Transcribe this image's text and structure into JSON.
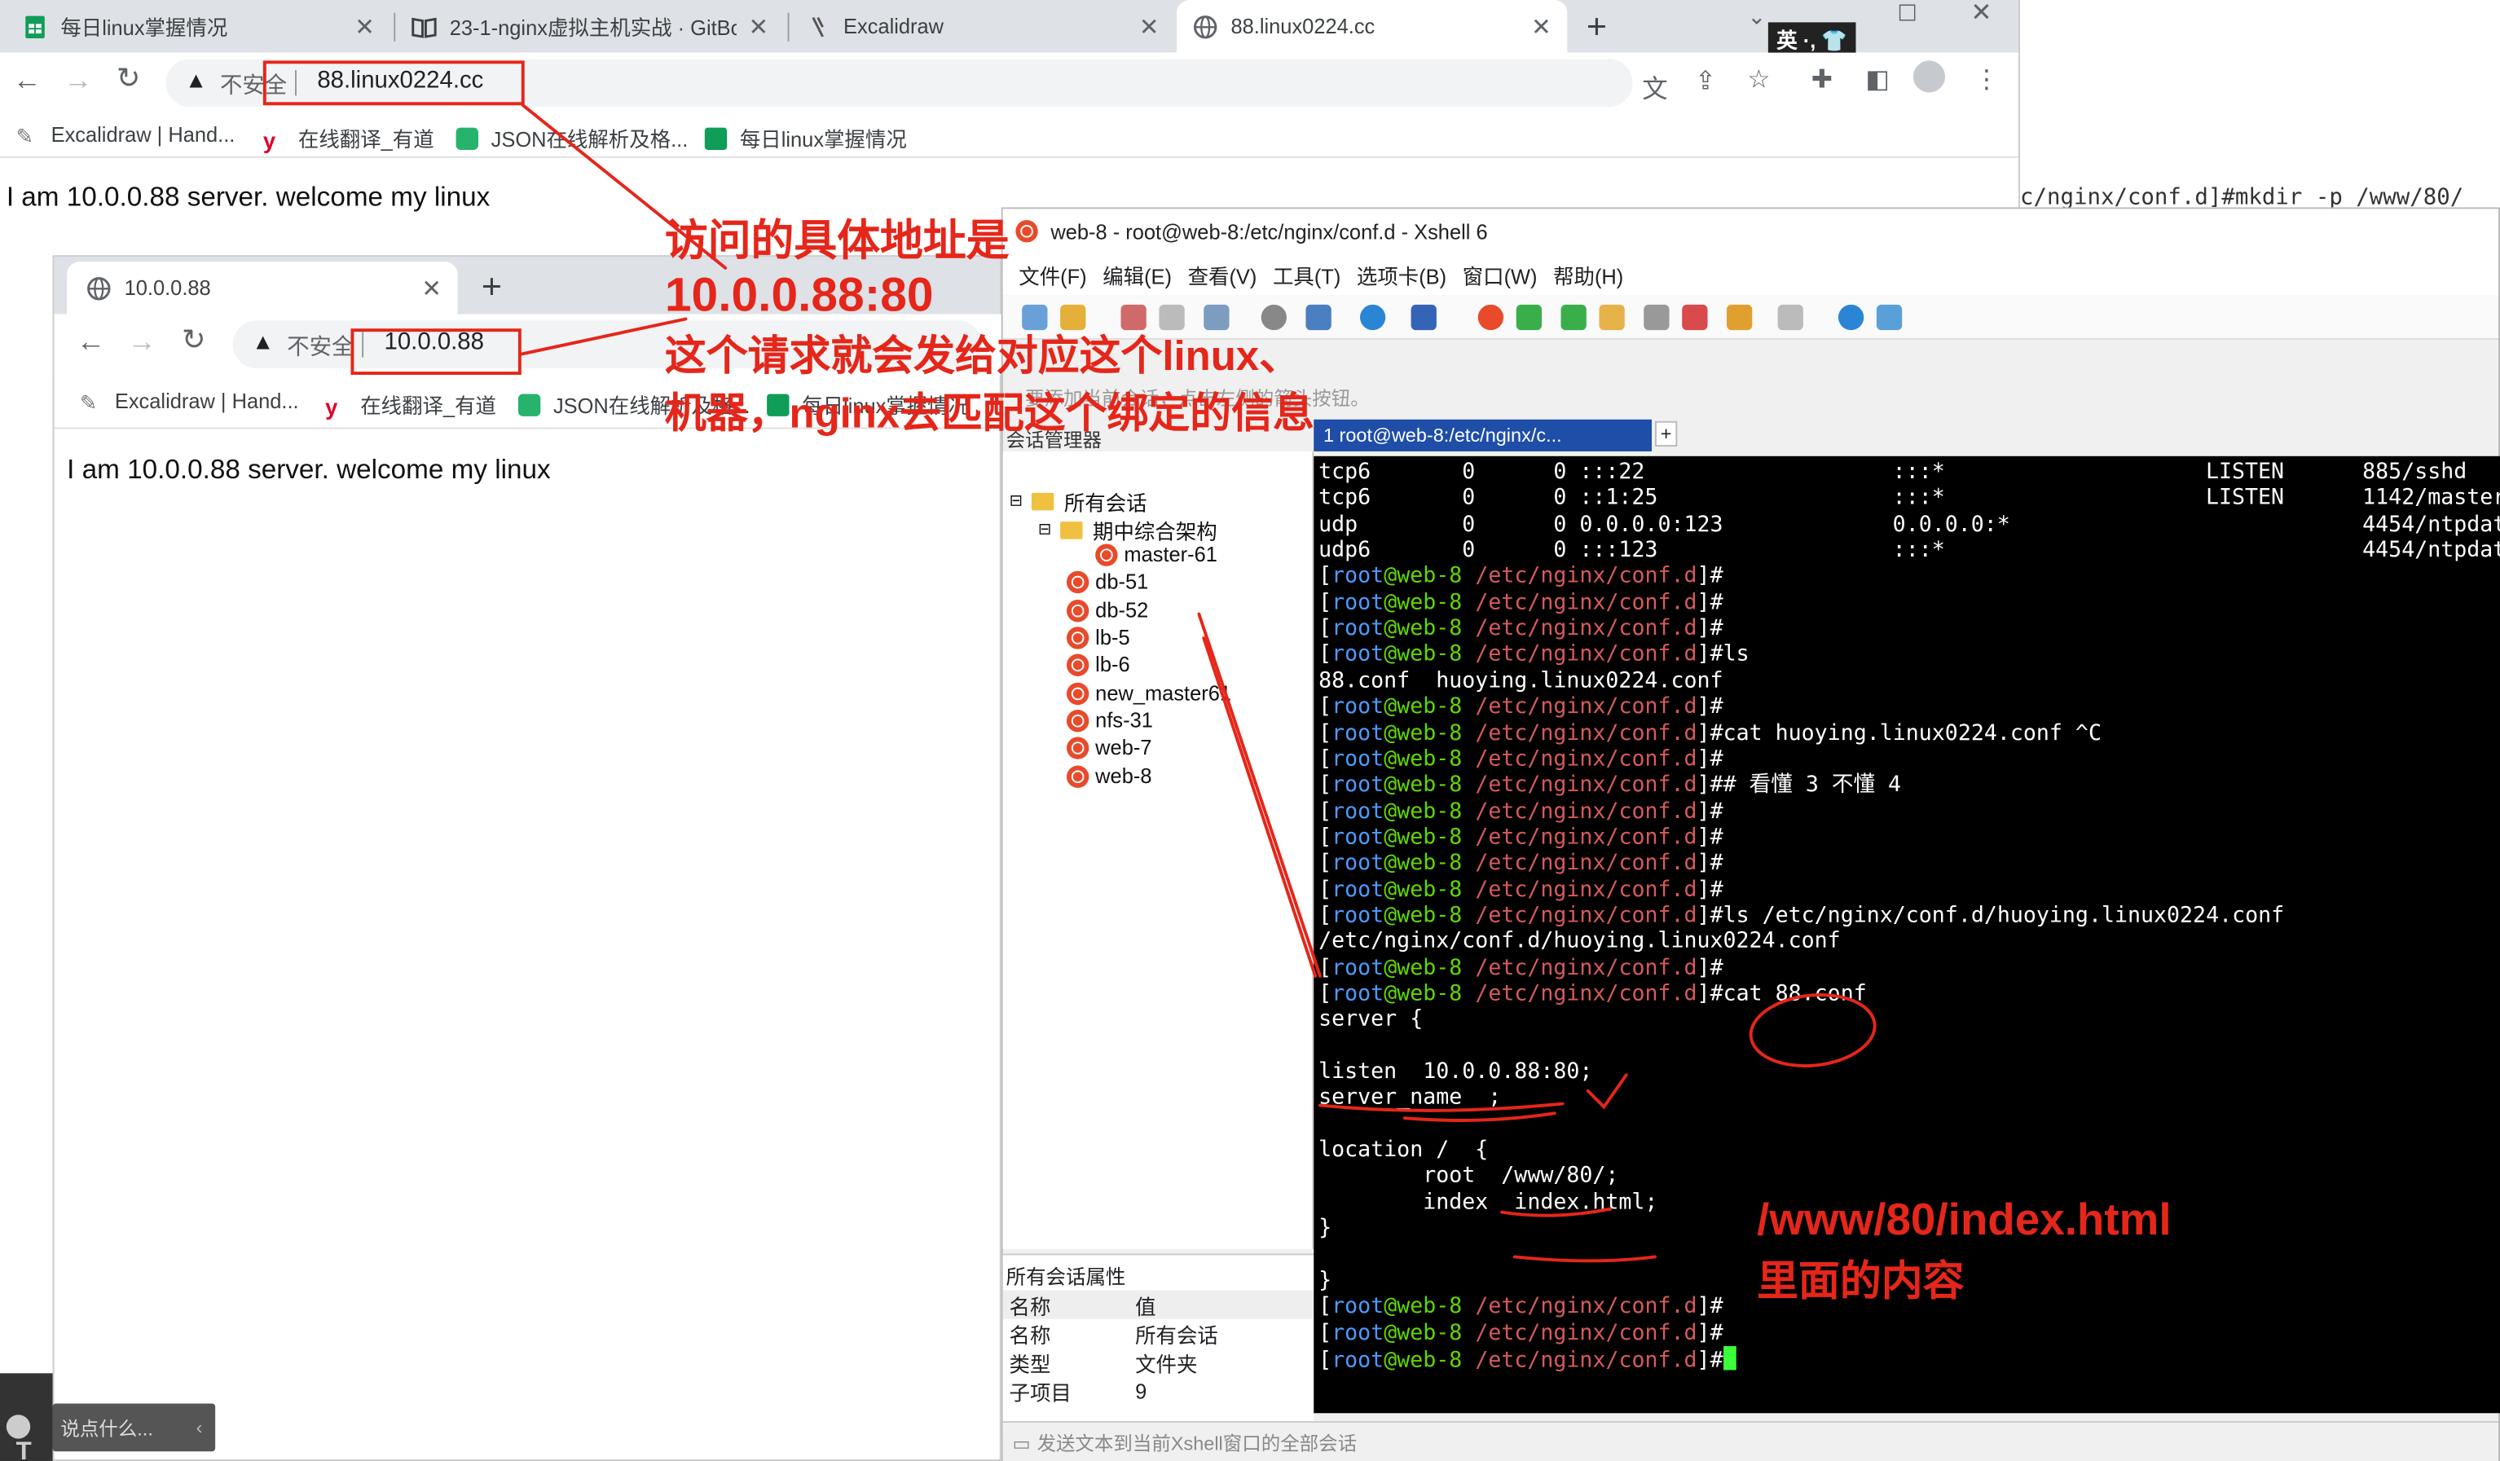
{
  "browser1": {
    "tabs": [
      {
        "label": "每日linux掌握情况"
      },
      {
        "label": "23-1-nginx虚拟主机实战 · GitBo"
      },
      {
        "label": "Excalidraw"
      },
      {
        "label": "88.linux0224.cc"
      }
    ],
    "address": {
      "security": "不安全",
      "url": "88.linux0224.cc"
    },
    "ime_badge": "英 ·, 👕",
    "bookmarks": [
      "Excalidraw | Hand...",
      "在线翻译_有道",
      "JSON在线解析及格...",
      "每日linux掌握情况"
    ],
    "page_text": "I am 10.0.0.88 server. welcome my linux",
    "behind_text": "c/nginx/conf.d]#mkdir -p /www/80/"
  },
  "browser2": {
    "tab": "10.0.0.88",
    "address": {
      "security": "不安全",
      "url": "10.0.0.88"
    },
    "bookmarks": [
      "Excalidraw | Hand...",
      "在线翻译_有道",
      "JSON在线解析及格...",
      "每日linux掌握情况"
    ],
    "page_text": "I am 10.0.0.88 server. welcome my linux"
  },
  "xshell": {
    "title": "web-8 - root@web-8:/etc/nginx/conf.d - Xshell 6",
    "menu": [
      "文件(F)",
      "编辑(E)",
      "查看(V)",
      "工具(T)",
      "选项卡(B)",
      "窗口(W)",
      "帮助(H)"
    ],
    "hint": "要添加当前会话，点击左侧的箭头按钮。",
    "session_manager_title": "会话管理器",
    "session_tab": "1 root@web-8:/etc/nginx/c...",
    "tree": [
      {
        "label": "所有会话",
        "kind": "folder",
        "level": 0
      },
      {
        "label": "期中综合架构",
        "kind": "folder",
        "level": 1
      },
      {
        "label": "master-61",
        "kind": "session",
        "level": 2
      },
      {
        "label": "db-51",
        "kind": "session",
        "level": 1
      },
      {
        "label": "db-52",
        "kind": "session",
        "level": 1
      },
      {
        "label": "lb-5",
        "kind": "session",
        "level": 1
      },
      {
        "label": "lb-6",
        "kind": "session",
        "level": 1
      },
      {
        "label": "new_master61",
        "kind": "session",
        "level": 1
      },
      {
        "label": "nfs-31",
        "kind": "session",
        "level": 1
      },
      {
        "label": "web-7",
        "kind": "session",
        "level": 1
      },
      {
        "label": "web-8",
        "kind": "session",
        "level": 1
      }
    ],
    "props": {
      "title": "所有会话属性",
      "headers": [
        "名称",
        "值"
      ],
      "rows": [
        [
          "名称",
          "所有会话"
        ],
        [
          "类型",
          "文件夹"
        ],
        [
          "子项目",
          "9"
        ]
      ]
    },
    "status_bar": "发送文本到当前Xshell窗口的全部会话",
    "prompt": {
      "user": "root",
      "host": "web-8",
      "path": "/etc/nginx/conf.d"
    },
    "terminal_lines": [
      {
        "type": "text",
        "text": "tcp6       0      0 :::22                   :::*                    LISTEN      885/sshd"
      },
      {
        "type": "text",
        "text": "tcp6       0      0 ::1:25                  :::*                    LISTEN      1142/master"
      },
      {
        "type": "text",
        "text": "udp        0      0 0.0.0.0:123             0.0.0.0:*                           4454/ntpdat"
      },
      {
        "type": "text",
        "text": "udp6       0      0 :::123                  :::*                                4454/ntpdat"
      },
      {
        "type": "prompt",
        "cmd": ""
      },
      {
        "type": "prompt",
        "cmd": ""
      },
      {
        "type": "prompt",
        "cmd": ""
      },
      {
        "type": "prompt",
        "cmd": "ls"
      },
      {
        "type": "text",
        "text": "88.conf  huoying.linux0224.conf"
      },
      {
        "type": "prompt",
        "cmd": ""
      },
      {
        "type": "prompt",
        "cmd": "cat huoying.linux0224.conf ^C"
      },
      {
        "type": "prompt",
        "cmd": ""
      },
      {
        "type": "prompt",
        "cmd": "# 看懂 3 不懂 4"
      },
      {
        "type": "prompt",
        "cmd": ""
      },
      {
        "type": "prompt",
        "cmd": ""
      },
      {
        "type": "prompt",
        "cmd": ""
      },
      {
        "type": "prompt",
        "cmd": ""
      },
      {
        "type": "prompt",
        "cmd": "ls /etc/nginx/conf.d/huoying.linux0224.conf"
      },
      {
        "type": "text",
        "text": "/etc/nginx/conf.d/huoying.linux0224.conf"
      },
      {
        "type": "prompt",
        "cmd": ""
      },
      {
        "type": "prompt",
        "cmd": "cat 88.conf"
      },
      {
        "type": "text",
        "text": "server {"
      },
      {
        "type": "text",
        "text": ""
      },
      {
        "type": "text",
        "text": "listen  10.0.0.88:80;"
      },
      {
        "type": "text",
        "text": "server_name _;"
      },
      {
        "type": "text",
        "text": ""
      },
      {
        "type": "text",
        "text": "location /  {"
      },
      {
        "type": "text",
        "text": "        root  /www/80/;"
      },
      {
        "type": "text",
        "text": "        index  index.html;"
      },
      {
        "type": "text",
        "text": "}"
      },
      {
        "type": "text",
        "text": ""
      },
      {
        "type": "text",
        "text": "}"
      },
      {
        "type": "prompt",
        "cmd": ""
      },
      {
        "type": "prompt",
        "cmd": ""
      },
      {
        "type": "prompt",
        "cmd": "",
        "cursor": true
      }
    ]
  },
  "annotations": {
    "addr_note": [
      "访问的具体地址是",
      "10.0.0.88:80",
      "这个请求就会发给对应这个linux、",
      "机器，nginx去匹配这个绑定的信息"
    ],
    "file_note": [
      "/www/80/index.html",
      "里面的内容"
    ],
    "color": "#e5261a"
  },
  "chat_input_placeholder": "说点什么..."
}
